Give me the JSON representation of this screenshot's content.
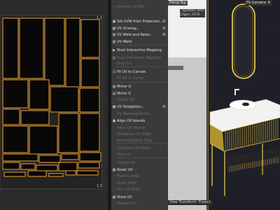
{
  "uv_editor": {
    "coord_top_right": "1,1",
    "coord_bottom_right": "1,0"
  },
  "menu": {
    "items": [
      {
        "label": "Remove UV Kits",
        "enabled": false,
        "icon": "remove-kits-icon",
        "glyph": "▫",
        "gear": false
      },
      {
        "label": "Set UVW from Projection...",
        "enabled": true,
        "icon": "projection-icon",
        "glyph": "▣",
        "gear": true
      },
      {
        "label": "UV Unwrap...",
        "enabled": true,
        "icon": "unwrap-icon",
        "glyph": "▦",
        "gear": true
      },
      {
        "label": "UV Weld and Relax...",
        "enabled": true,
        "icon": "weld-relax-icon",
        "glyph": "▧",
        "gear": true
      },
      {
        "label": "UV Weld",
        "enabled": true,
        "icon": "weld-icon",
        "glyph": "▨",
        "gear": false
      },
      {
        "label": "Start Interactive Mapping",
        "enabled": true,
        "icon": "play-icon",
        "glyph": "▶",
        "gear": false
      },
      {
        "label": "Stop Interactive Mapping",
        "enabled": false,
        "icon": "stop-icon",
        "glyph": "■",
        "gear": false
      },
      {
        "label": "Snap UV",
        "enabled": false,
        "icon": "snap-uv-icon",
        "glyph": "·",
        "gear": false
      },
      {
        "label": "Fit UV to Canvas",
        "enabled": true,
        "icon": "fit-canvas-icon",
        "glyph": "⊡",
        "gear": false
      },
      {
        "label": "Fit UV to Cursor",
        "enabled": false,
        "icon": "fit-cursor-icon",
        "glyph": "·",
        "gear": false
      },
      {
        "label": "Mirror U",
        "enabled": true,
        "icon": "mirror-u-icon",
        "glyph": "▥",
        "gear": false
      },
      {
        "label": "Mirror V",
        "enabled": true,
        "icon": "mirror-v-icon",
        "glyph": "▤",
        "gear": false
      },
      {
        "label": "Rotate 90",
        "enabled": false,
        "icon": "rotate-icon",
        "glyph": "·",
        "gear": false
      },
      {
        "label": "UV Straighten...",
        "enabled": true,
        "icon": "straighten-icon",
        "glyph": "▩",
        "gear": true
      },
      {
        "label": "UV Rectangularize...",
        "enabled": false,
        "icon": "rectangularize-icon",
        "glyph": "·",
        "gear": false
      },
      {
        "label": "Align UV Islands",
        "enabled": true,
        "icon": "align-icon",
        "glyph": "▣",
        "gear": false
      },
      {
        "label": "Align UV Islands",
        "enabled": false,
        "icon": "align-disabled-icon",
        "glyph": "·",
        "gear": false
      },
      {
        "label": "Straighten UV Edge",
        "enabled": false,
        "icon": "straighten-edge-icon",
        "glyph": "·",
        "gear": false
      },
      {
        "label": "Rectangularize Edge",
        "enabled": false,
        "icon": "rect-edge-icon",
        "glyph": "·",
        "gear": false
      },
      {
        "label": "Separate UV Edges",
        "enabled": false,
        "icon": "separate-icon",
        "glyph": "·",
        "gear": false
      },
      {
        "label": "Hide UV",
        "enabled": false,
        "icon": "hide-uv-icon",
        "glyph": "·",
        "gear": false
      },
      {
        "label": "Unhide UV",
        "enabled": false,
        "icon": "unhide-uv-icon",
        "glyph": "·",
        "gear": false
      },
      {
        "label": "Reset UV",
        "enabled": true,
        "icon": "reset-uv-icon",
        "glyph": "▦",
        "gear": false
      },
      {
        "label": "Flatten UVW",
        "enabled": false,
        "icon": "flatten-icon",
        "glyph": "·",
        "gear": false
      },
      {
        "label": "Quick UVW",
        "enabled": false,
        "icon": "quick-uvw-icon",
        "glyph": "·",
        "gear": false
      },
      {
        "label": "Pick UV Shell",
        "enabled": false,
        "icon": "pick-shell-icon",
        "glyph": "·",
        "gear": false
      },
      {
        "label": "Store UV",
        "enabled": true,
        "icon": "store-uv-icon",
        "glyph": "▦",
        "gear": false
      },
      {
        "label": "Restore UV",
        "enabled": false,
        "icon": "restore-uv-icon",
        "glyph": "·",
        "gear": false
      }
    ]
  },
  "viewport": {
    "tag_left": "Persp Top",
    "tag_right": "FS Camera: 4",
    "info_line1": "Updated Total",
    "info_line2": "Edges: 7578",
    "info_line2_value": "7578",
    "bottom_label": "View Transform: Project"
  },
  "colors": {
    "uv_island": "#f0a030",
    "highlight": "#f5d84a"
  }
}
